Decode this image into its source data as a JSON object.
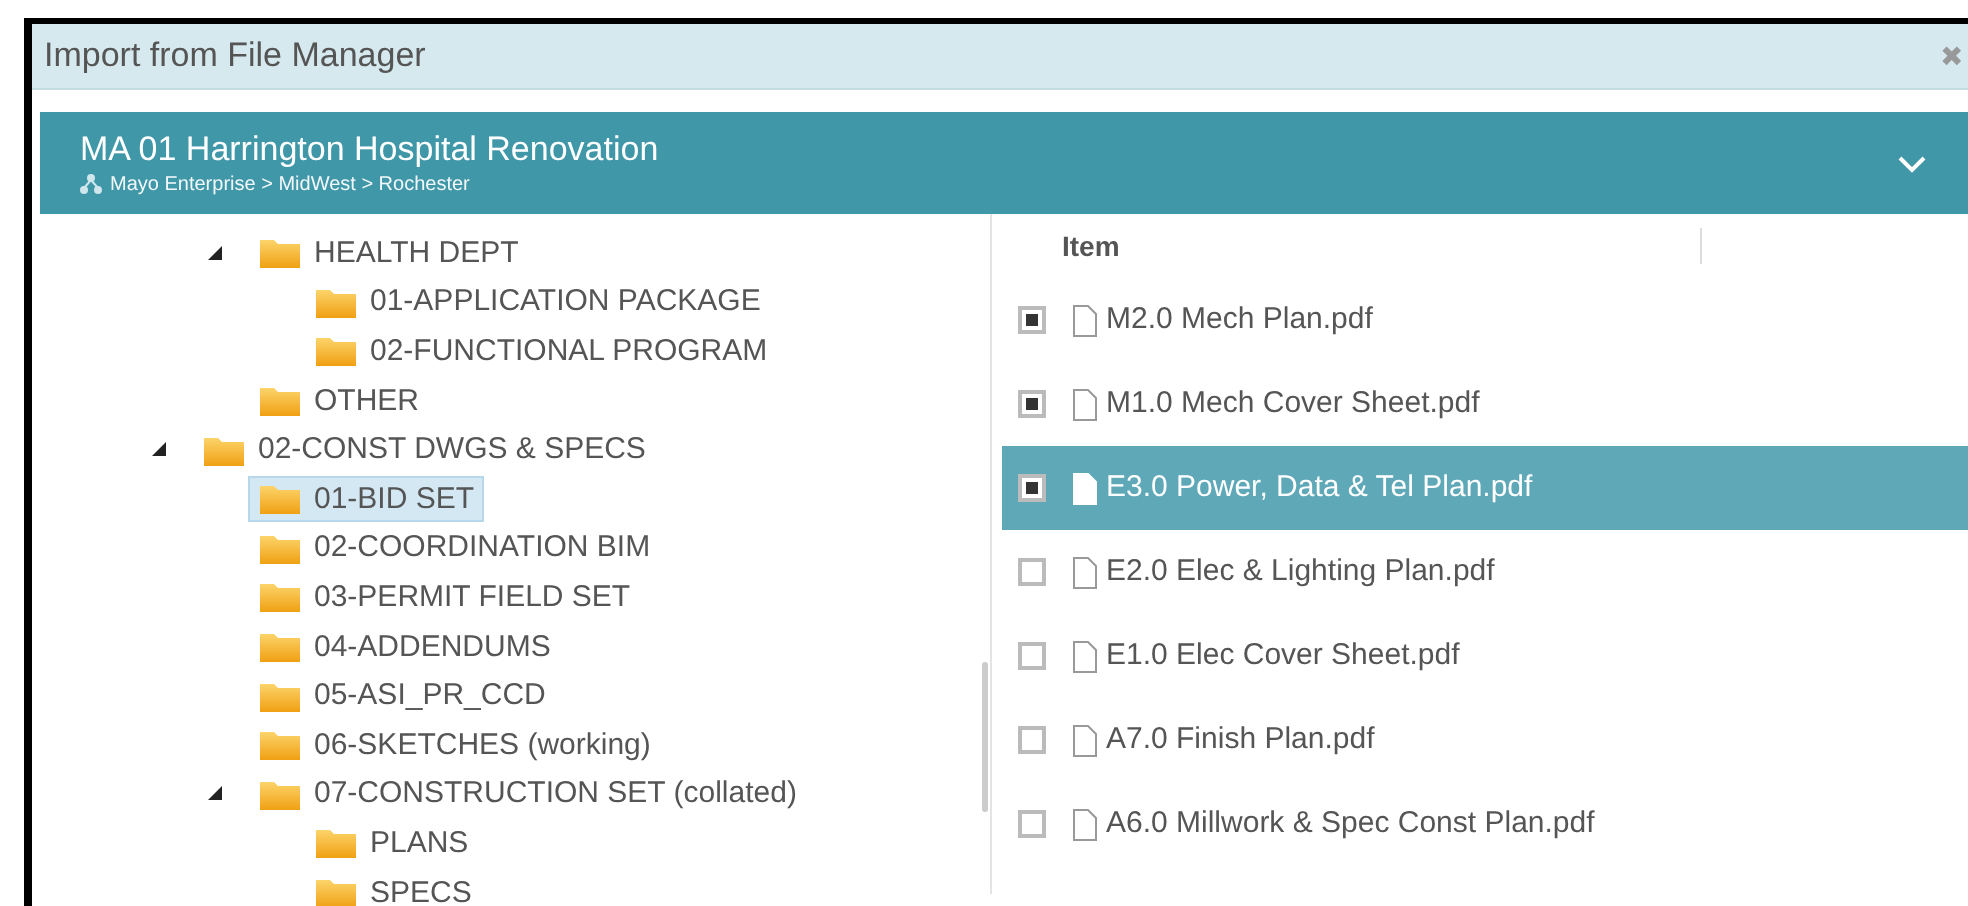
{
  "dialog": {
    "title": "Import from File Manager",
    "close": "✖"
  },
  "project": {
    "title": "MA 01 Harrington Hospital Renovation",
    "path": "Mayo Enterprise > MidWest > Rochester",
    "expanded": false
  },
  "tree": [
    {
      "children": [
        {
          "label": "HEALTH DEPT",
          "expanded": true,
          "selected": false,
          "children": [
            {
              "label": "01-APPLICATION PACKAGE",
              "selected": false
            },
            {
              "label": "02-FUNCTIONAL PROGRAM",
              "selected": false
            }
          ]
        },
        {
          "label": "OTHER",
          "selected": false
        }
      ]
    },
    {
      "label": "02-CONST DWGS & SPECS",
      "expanded": true,
      "selected": false,
      "children": [
        {
          "label": "01-BID SET",
          "selected": true
        },
        {
          "label": "02-COORDINATION BIM",
          "selected": false
        },
        {
          "label": "03-PERMIT FIELD SET",
          "selected": false
        },
        {
          "label": "04-ADDENDUMS",
          "selected": false
        },
        {
          "label": "05-ASI_PR_CCD",
          "selected": false
        },
        {
          "label": "06-SKETCHES (working)",
          "selected": false
        },
        {
          "label": "07-CONSTRUCTION SET (collated)",
          "expanded": true,
          "selected": false,
          "children": [
            {
              "label": "PLANS",
              "selected": false
            },
            {
              "label": "SPECS",
              "selected": false
            }
          ]
        }
      ]
    }
  ],
  "files": {
    "columns": [
      "Item"
    ],
    "rows": [
      {
        "name": "M2.0 Mech Plan.pdf",
        "checked": true,
        "selected": false
      },
      {
        "name": "M1.0 Mech Cover Sheet.pdf",
        "checked": true,
        "selected": false
      },
      {
        "name": "E3.0 Power, Data & Tel Plan.pdf",
        "checked": true,
        "selected": true
      },
      {
        "name": "E2.0 Elec & Lighting Plan.pdf",
        "checked": false,
        "selected": false
      },
      {
        "name": "E1.0 Elec Cover Sheet.pdf",
        "checked": false,
        "selected": false
      },
      {
        "name": "A7.0 Finish Plan.pdf",
        "checked": false,
        "selected": false
      },
      {
        "name": "A6.0 Millwork & Spec Const Plan.pdf",
        "checked": false,
        "selected": false
      }
    ]
  }
}
